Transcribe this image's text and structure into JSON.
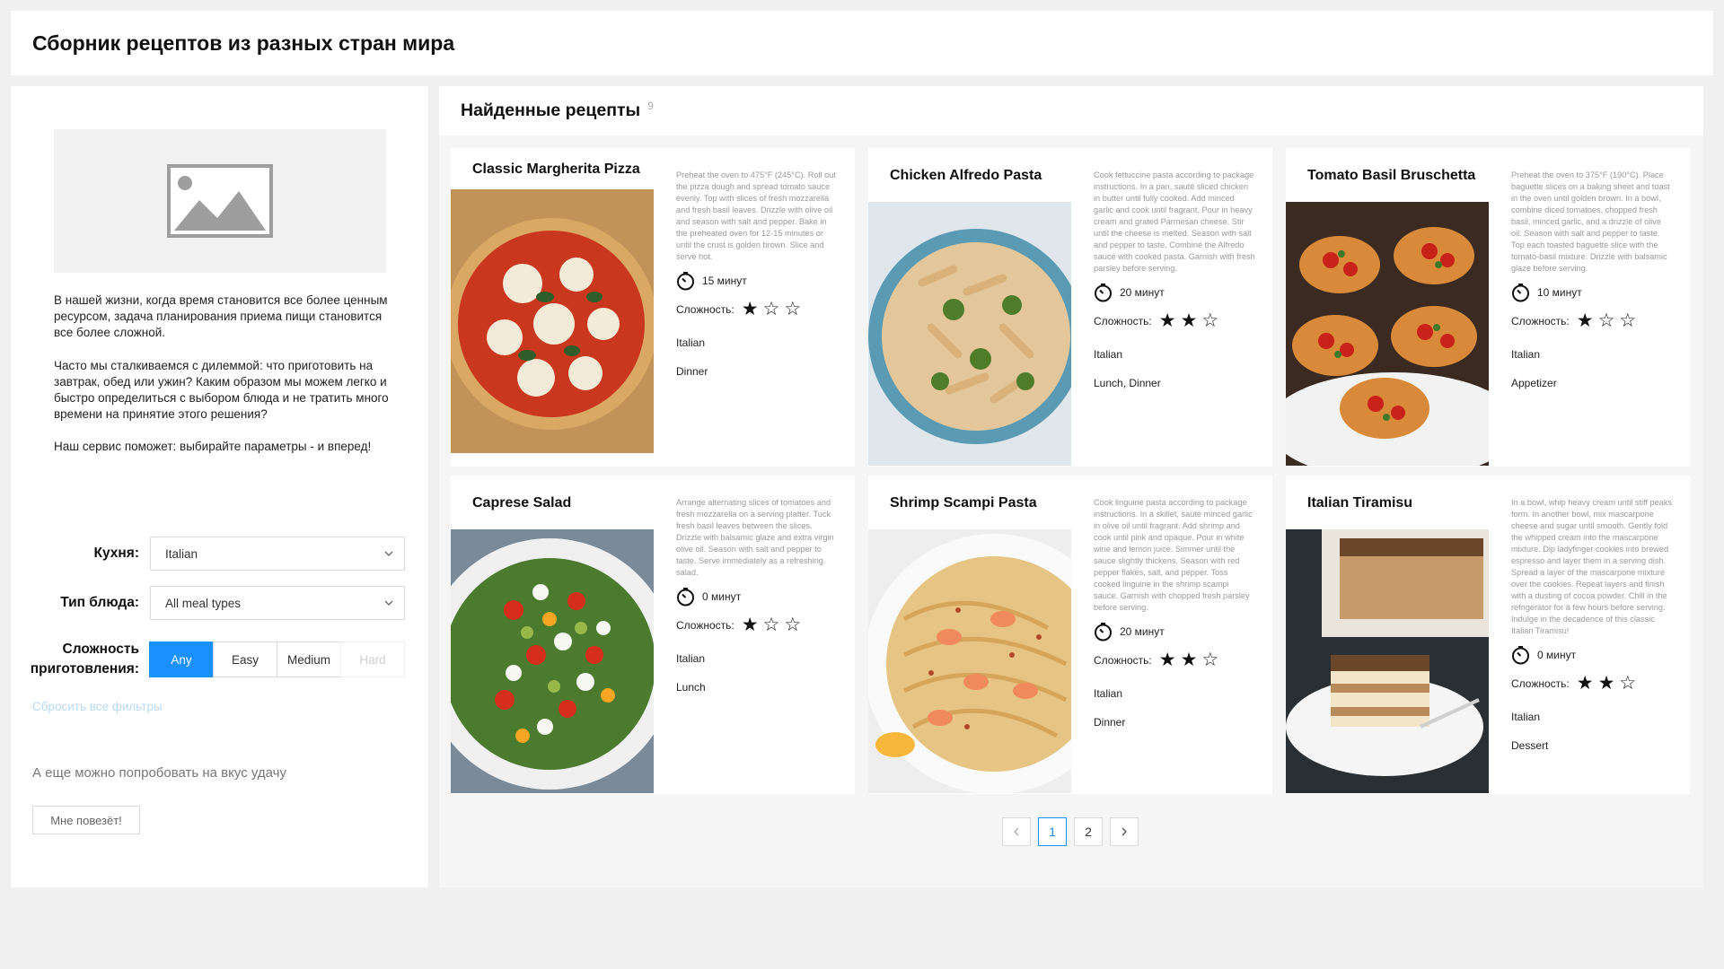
{
  "header": {
    "title": "Сборник рецептов из разных стран мира"
  },
  "sidebar": {
    "intro": [
      "В нашей жизни, когда время становится все более ценным ресурсом, задача планирования приема пищи становится все более сложной.",
      "Часто мы сталкиваемся с дилеммой: что приготовить на завтрак, обед или ужин? Каким образом мы можем легко и быстро определиться с выбором блюда и не тратить много времени на принятие этого решения?",
      "Наш сервис поможет: выбирайте параметры - и вперед!"
    ],
    "cuisine_label": "Кухня:",
    "cuisine_value": "Italian",
    "meal_type_label": "Тип блюда:",
    "meal_type_value": "All meal types",
    "difficulty_label_1": "Сложность",
    "difficulty_label_2": "приготовления:",
    "difficulty_options": [
      "Any",
      "Easy",
      "Medium",
      "Hard"
    ],
    "difficulty_selected": "Any",
    "reset_link": "Сбросить все фильтры",
    "luck_text": "А еще можно попробовать на вкус удачу",
    "luck_button": "Мне повезёт!"
  },
  "main": {
    "title": "Найденные рецепты",
    "count": "9",
    "time_suffix": "минут",
    "difficulty_label": "Сложность:",
    "recipes": [
      {
        "title": "Classic Margherita Pizza",
        "description": "Preheat the oven to 475°F (245°C). Roll out the pizza dough and spread tomato sauce evenly. Top with slices of fresh mozzarella and fresh basil leaves. Drizzle with olive oil and season with salt and pepper. Bake in the preheated oven for 12-15 minutes or until the crust is golden brown. Slice and serve hot.",
        "time": "15 минут",
        "difficulty": 1,
        "cuisine": "Italian",
        "meal": "Dinner",
        "image_icon": "pizza-photo"
      },
      {
        "title": "Chicken Alfredo Pasta",
        "description": "Cook fettuccine pasta according to package instructions. In a pan, sauté sliced chicken in butter until fully cooked. Add minced garlic and cook until fragrant. Pour in heavy cream and grated Parmesan cheese. Stir until the cheese is melted. Season with salt and pepper to taste. Combine the Alfredo sauce with cooked pasta. Garnish with fresh parsley before serving.",
        "time": "20 минут",
        "difficulty": 2,
        "cuisine": "Italian",
        "meal": "Lunch, Dinner",
        "image_icon": "pasta-photo"
      },
      {
        "title": "Tomato Basil Bruschetta",
        "description": "Preheat the oven to 375°F (190°C). Place baguette slices on a baking sheet and toast in the oven until golden brown. In a bowl, combine diced tomatoes, chopped fresh basil, minced garlic, and a drizzle of olive oil. Season with salt and pepper to taste. Top each toasted baguette slice with the tomato-basil mixture. Drizzle with balsamic glaze before serving.",
        "time": "10 минут",
        "difficulty": 1,
        "cuisine": "Italian",
        "meal": "Appetizer",
        "image_icon": "bruschetta-photo"
      },
      {
        "title": "Caprese Salad",
        "description": "Arrange alternating slices of tomatoes and fresh mozzarella on a serving platter. Tuck fresh basil leaves between the slices. Drizzle with balsamic glaze and extra virgin olive oil. Season with salt and pepper to taste. Serve immediately as a refreshing salad.",
        "time": "0 минут",
        "difficulty": 1,
        "cuisine": "Italian",
        "meal": "Lunch",
        "image_icon": "salad-photo"
      },
      {
        "title": "Shrimp Scampi Pasta",
        "description": "Cook linguine pasta according to package instructions. In a skillet, sauté minced garlic in olive oil until fragrant. Add shrimp and cook until pink and opaque. Pour in white wine and lemon juice. Simmer until the sauce slightly thickens. Season with red pepper flakes, salt, and pepper. Toss cooked linguine in the shrimp scampi sauce. Garnish with chopped fresh parsley before serving.",
        "time": "20 минут",
        "difficulty": 2,
        "cuisine": "Italian",
        "meal": "Dinner",
        "image_icon": "shrimp-pasta-photo"
      },
      {
        "title": "Italian Tiramisu",
        "description": "In a bowl, whip heavy cream until stiff peaks form. In another bowl, mix mascarpone cheese and sugar until smooth. Gently fold the whipped cream into the mascarpone mixture. Dip ladyfinger cookies into brewed espresso and layer them in a serving dish. Spread a layer of the mascarpone mixture over the cookies. Repeat layers and finish with a dusting of cocoa powder. Chill in the refrigerator for a few hours before serving. Indulge in the decadence of this classic Italian Tiramisu!",
        "time": "0 минут",
        "difficulty": 2,
        "cuisine": "Italian",
        "meal": "Dessert",
        "image_icon": "tiramisu-photo"
      }
    ],
    "pagination": {
      "pages": [
        "1",
        "2"
      ],
      "current": "1"
    }
  },
  "colors": {
    "accent": "#1890ff",
    "star": "#111111"
  }
}
